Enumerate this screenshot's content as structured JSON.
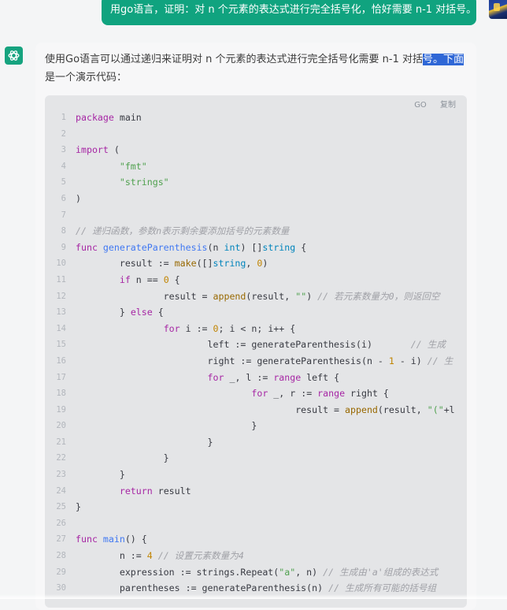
{
  "user_message": {
    "text": "用go语言，证明：对 n 个元素的表达式进行完全括号化，恰好需要 n-1 对括号。"
  },
  "assistant": {
    "intro_before": "使用Go语言可以通过递归来证明对 n 个元素的表达式进行完全括号化需要 n-1 对括",
    "intro_highlight": "号。下面",
    "intro_after": "是一个演示代码：",
    "code_block": {
      "language": "GO",
      "copy_label": "复制",
      "lines": [
        {
          "num": "1",
          "segs": [
            [
              "k",
              "package"
            ],
            [
              "p",
              " main"
            ]
          ]
        },
        {
          "num": "2",
          "segs": []
        },
        {
          "num": "3",
          "segs": [
            [
              "k",
              "import"
            ],
            [
              "p",
              " ("
            ]
          ]
        },
        {
          "num": "4",
          "segs": [
            [
              "p",
              "        "
            ],
            [
              "s",
              "\"fmt\""
            ]
          ]
        },
        {
          "num": "5",
          "segs": [
            [
              "p",
              "        "
            ],
            [
              "s",
              "\"strings\""
            ]
          ]
        },
        {
          "num": "6",
          "segs": [
            [
              "p",
              ")"
            ]
          ]
        },
        {
          "num": "7",
          "segs": []
        },
        {
          "num": "8",
          "segs": [
            [
              "c",
              "// 递归函数，参数n表示剩余要添加括号的元素数量"
            ]
          ]
        },
        {
          "num": "9",
          "segs": [
            [
              "k",
              "func"
            ],
            [
              "p",
              " "
            ],
            [
              "f",
              "generateParenthesis"
            ],
            [
              "p",
              "(n "
            ],
            [
              "t",
              "int"
            ],
            [
              "p",
              ") []"
            ],
            [
              "t",
              "string"
            ],
            [
              "p",
              " {"
            ]
          ]
        },
        {
          "num": "10",
          "segs": [
            [
              "p",
              "        result := "
            ],
            [
              "b",
              "make"
            ],
            [
              "p",
              "([]"
            ],
            [
              "t",
              "string"
            ],
            [
              "p",
              ", "
            ],
            [
              "n",
              "0"
            ],
            [
              "p",
              ")"
            ]
          ]
        },
        {
          "num": "11",
          "segs": [
            [
              "p",
              "        "
            ],
            [
              "k",
              "if"
            ],
            [
              "p",
              " n == "
            ],
            [
              "n",
              "0"
            ],
            [
              "p",
              " {"
            ]
          ]
        },
        {
          "num": "12",
          "segs": [
            [
              "p",
              "                result = "
            ],
            [
              "b",
              "append"
            ],
            [
              "p",
              "(result, "
            ],
            [
              "s",
              "\"\""
            ],
            [
              "p",
              ") "
            ],
            [
              "c",
              "// 若元素数量为0，则返回空"
            ]
          ]
        },
        {
          "num": "13",
          "segs": [
            [
              "p",
              "        } "
            ],
            [
              "k",
              "else"
            ],
            [
              "p",
              " {"
            ]
          ]
        },
        {
          "num": "14",
          "segs": [
            [
              "p",
              "                "
            ],
            [
              "k",
              "for"
            ],
            [
              "p",
              " i := "
            ],
            [
              "n",
              "0"
            ],
            [
              "p",
              "; i < n; i++ {"
            ]
          ]
        },
        {
          "num": "15",
          "segs": [
            [
              "p",
              "                        left := generateParenthesis(i)       "
            ],
            [
              "c",
              "// 生成"
            ]
          ]
        },
        {
          "num": "16",
          "segs": [
            [
              "p",
              "                        right := generateParenthesis(n - "
            ],
            [
              "n",
              "1"
            ],
            [
              "p",
              " - i) "
            ],
            [
              "c",
              "// 生"
            ]
          ]
        },
        {
          "num": "17",
          "segs": [
            [
              "p",
              "                        "
            ],
            [
              "k",
              "for"
            ],
            [
              "p",
              " _, l := "
            ],
            [
              "k",
              "range"
            ],
            [
              "p",
              " left {"
            ]
          ]
        },
        {
          "num": "18",
          "segs": [
            [
              "p",
              "                                "
            ],
            [
              "k",
              "for"
            ],
            [
              "p",
              " _, r := "
            ],
            [
              "k",
              "range"
            ],
            [
              "p",
              " right {"
            ]
          ]
        },
        {
          "num": "19",
          "segs": [
            [
              "p",
              "                                        result = "
            ],
            [
              "b",
              "append"
            ],
            [
              "p",
              "(result, "
            ],
            [
              "s",
              "\"(\""
            ],
            [
              "p",
              "+l"
            ]
          ]
        },
        {
          "num": "20",
          "segs": [
            [
              "p",
              "                                }"
            ]
          ]
        },
        {
          "num": "21",
          "segs": [
            [
              "p",
              "                        }"
            ]
          ]
        },
        {
          "num": "22",
          "segs": [
            [
              "p",
              "                }"
            ]
          ]
        },
        {
          "num": "23",
          "segs": [
            [
              "p",
              "        }"
            ]
          ]
        },
        {
          "num": "24",
          "segs": [
            [
              "p",
              "        "
            ],
            [
              "k",
              "return"
            ],
            [
              "p",
              " result"
            ]
          ]
        },
        {
          "num": "25",
          "segs": [
            [
              "p",
              "}"
            ]
          ]
        },
        {
          "num": "26",
          "segs": []
        },
        {
          "num": "27",
          "segs": [
            [
              "k",
              "func"
            ],
            [
              "p",
              " "
            ],
            [
              "f",
              "main"
            ],
            [
              "p",
              "() {"
            ]
          ]
        },
        {
          "num": "28",
          "segs": [
            [
              "p",
              "        n := "
            ],
            [
              "n",
              "4"
            ],
            [
              "p",
              " "
            ],
            [
              "c",
              "// 设置元素数量为4"
            ]
          ]
        },
        {
          "num": "29",
          "segs": [
            [
              "p",
              "        expression := strings.Repeat("
            ],
            [
              "s",
              "\"a\""
            ],
            [
              "p",
              ", n) "
            ],
            [
              "c",
              "// 生成由'a'组成的表达式"
            ]
          ]
        },
        {
          "num": "30",
          "segs": [
            [
              "p",
              "        parentheses := generateParenthesis(n) "
            ],
            [
              "c",
              "// 生成所有可能的括号组"
            ]
          ]
        }
      ]
    }
  }
}
